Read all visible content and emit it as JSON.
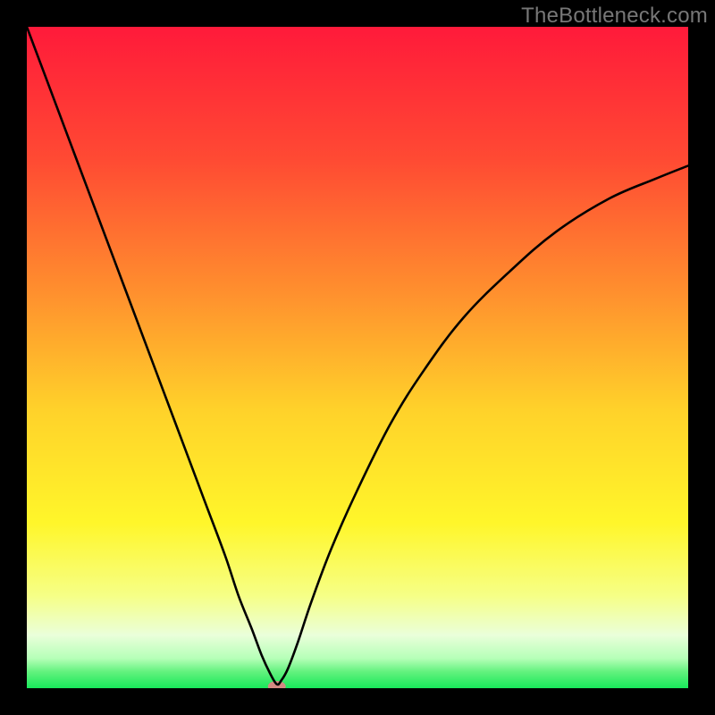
{
  "watermark": "TheBottleneck.com",
  "chart_data": {
    "type": "line",
    "title": "",
    "xlabel": "",
    "ylabel": "",
    "xlim": [
      0,
      100
    ],
    "ylim": [
      0,
      100
    ],
    "grid": false,
    "background_gradient": {
      "stops": [
        {
          "offset": 0.0,
          "color": "#ff1a3a"
        },
        {
          "offset": 0.2,
          "color": "#ff4a33"
        },
        {
          "offset": 0.4,
          "color": "#ff8f2e"
        },
        {
          "offset": 0.58,
          "color": "#ffd22a"
        },
        {
          "offset": 0.75,
          "color": "#fff62a"
        },
        {
          "offset": 0.86,
          "color": "#f6ff86"
        },
        {
          "offset": 0.92,
          "color": "#eaffda"
        },
        {
          "offset": 0.955,
          "color": "#b6ffb8"
        },
        {
          "offset": 0.975,
          "color": "#63f27e"
        },
        {
          "offset": 1.0,
          "color": "#18e85a"
        }
      ]
    },
    "series": [
      {
        "name": "bottleneck-curve",
        "color": "#000000",
        "x": [
          0,
          3,
          6,
          9,
          12,
          15,
          18,
          21,
          24,
          27,
          30,
          32,
          34,
          35.5,
          36.8,
          37.8,
          38.5,
          39.5,
          41,
          43,
          46,
          50,
          55,
          60,
          66,
          73,
          80,
          88,
          95,
          100
        ],
        "y": [
          100,
          92,
          84,
          76,
          68,
          60,
          52,
          44,
          36,
          28,
          20,
          14,
          9,
          5,
          2.2,
          0.6,
          1.2,
          3.0,
          7,
          13,
          21,
          30,
          40,
          48,
          56,
          63,
          69,
          74,
          77,
          79
        ]
      }
    ],
    "marker": {
      "name": "min-point",
      "x": 37.8,
      "y": 0.0,
      "color": "#d48a83",
      "rx": 10,
      "ry": 6
    }
  }
}
